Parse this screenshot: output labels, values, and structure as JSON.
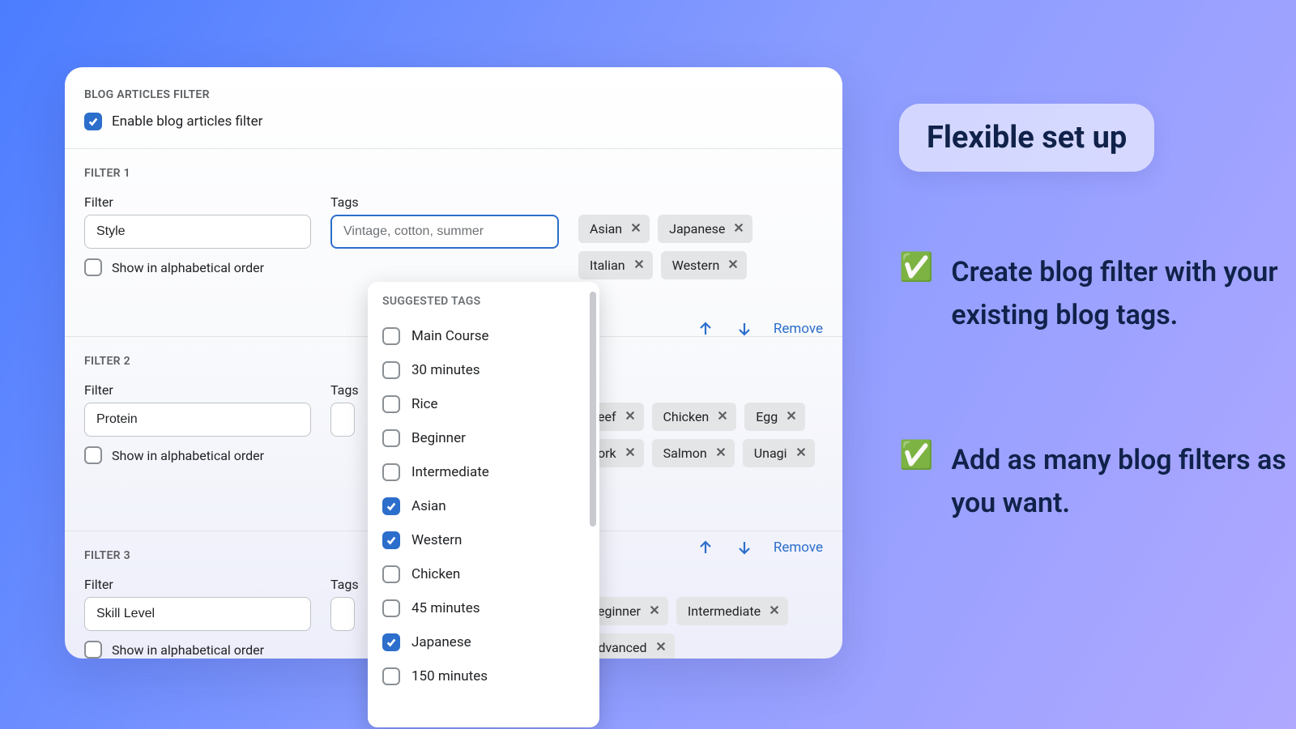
{
  "header": {
    "title_caps": "BLOG ARTICLES FILTER",
    "enable_label": "Enable blog articles filter",
    "enabled": true
  },
  "labels": {
    "filter": "Filter",
    "tags": "Tags",
    "alpha": "Show in alphabetical order",
    "remove": "Remove",
    "suggested_title": "SUGGESTED TAGS",
    "tags_placeholder": "Vintage, cotton, summer"
  },
  "filters": [
    {
      "header": "FILTER 1",
      "name": "Style",
      "alpha_checked": false,
      "tags": [
        "Asian",
        "Japanese",
        "Italian",
        "Western"
      ],
      "tags_input_focused": true
    },
    {
      "header": "FILTER 2",
      "name": "Protein",
      "alpha_checked": false,
      "tags": [
        "Beef",
        "Chicken",
        "Egg",
        "Pork",
        "Salmon",
        "Unagi"
      ]
    },
    {
      "header": "FILTER 3",
      "name": "Skill Level",
      "alpha_checked": false,
      "tags": [
        "Beginner",
        "Intermediate",
        "Advanced"
      ]
    }
  ],
  "suggested": [
    {
      "label": "Main Course",
      "checked": false
    },
    {
      "label": "30 minutes",
      "checked": false
    },
    {
      "label": "Rice",
      "checked": false
    },
    {
      "label": "Beginner",
      "checked": false
    },
    {
      "label": "Intermediate",
      "checked": false
    },
    {
      "label": "Asian",
      "checked": true
    },
    {
      "label": "Western",
      "checked": true
    },
    {
      "label": "Chicken",
      "checked": false
    },
    {
      "label": "45 minutes",
      "checked": false
    },
    {
      "label": "Japanese",
      "checked": true
    },
    {
      "label": "150 minutes",
      "checked": false
    }
  ],
  "marketing": {
    "pill": "Flexible set up",
    "feat1": "Create blog filter with your existing blog tags.",
    "feat2": "Add as many blog filters as you want.",
    "check_glyph": "✅"
  }
}
